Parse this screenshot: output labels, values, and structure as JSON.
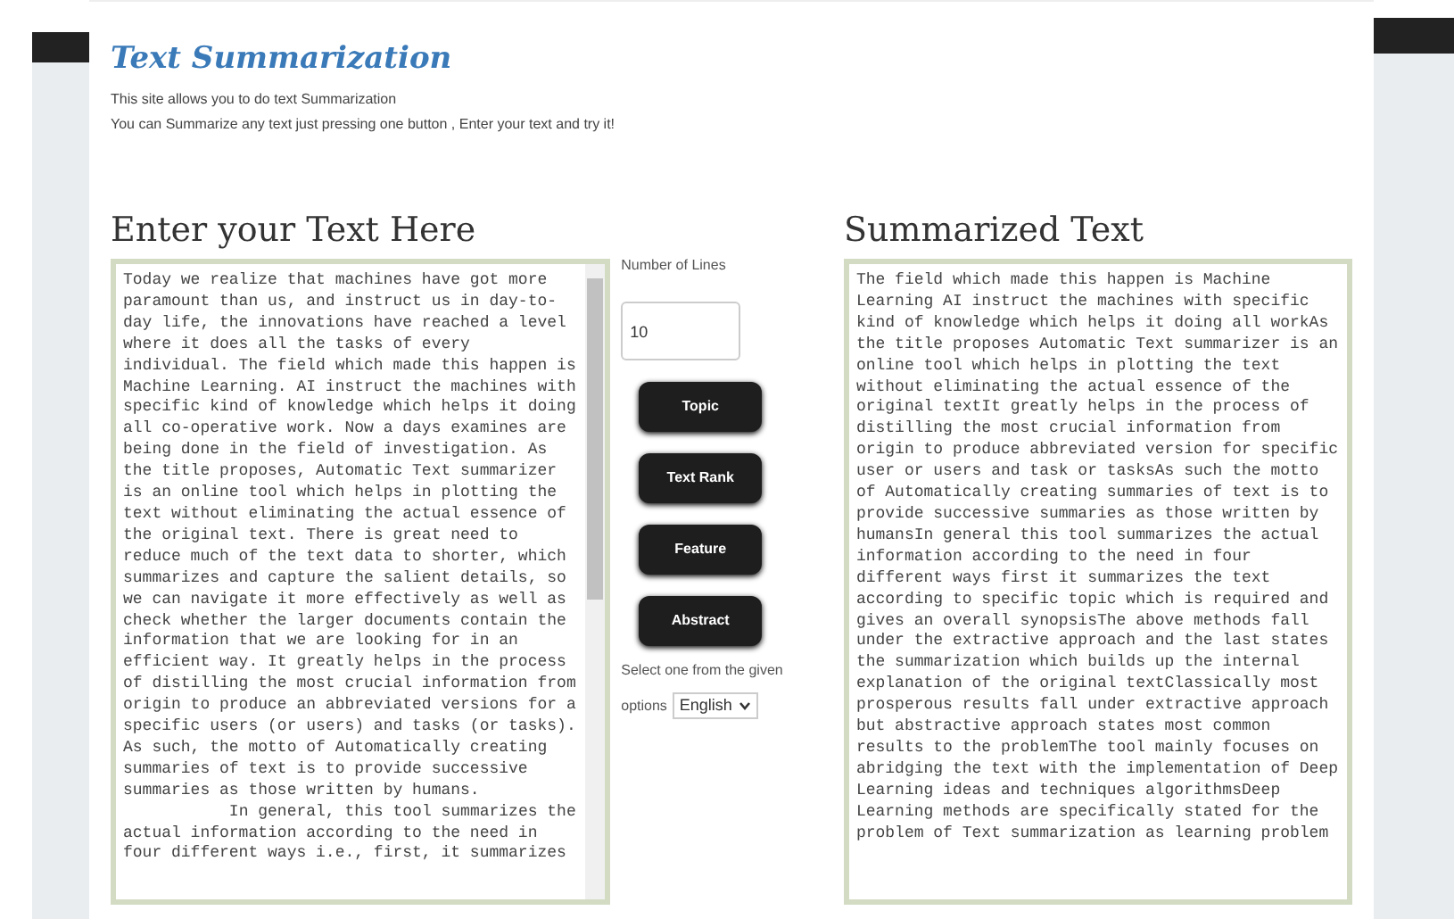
{
  "header": {
    "title": "Text Summarization",
    "lines": [
      "This site allows you to do text Summarization",
      "You can Summarize any text just pressing one button , Enter your text and try it!"
    ]
  },
  "input_panel": {
    "heading": "Enter your Text Here",
    "text": "Today we realize that machines have got more paramount than us, and instruct us in day-to-day life, the innovations have reached a level where it does all the tasks of every individual. The field which made this happen is Machine Learning. AI instruct the machines with specific kind of knowledge which helps it doing all co-operative work. Now a days examines are being done in the field of investigation. As the title proposes, Automatic Text summarizer is an online tool which helps in plotting the text without eliminating the actual essence of the original text. There is great need to reduce much of the text data to shorter, which summarizes and capture the salient details, so we can navigate it more effectively as well as check whether the larger documents contain the information that we are looking for in an efficient way. It greatly helps in the process of distilling the most crucial information from origin to produce an abbreviated versions for a specific users (or users) and tasks (or tasks). As such, the motto of Automatically creating summaries of text is to provide successive summaries as those written by humans.\n           In general, this tool summarizes the actual information according to the need in four different ways i.e., first, it summarizes"
  },
  "controls": {
    "lines_label": "Number of Lines",
    "lines_value": "10",
    "buttons": [
      "Topic",
      "Text Rank",
      "Feature",
      "Abstract"
    ],
    "select_label_1": "Select one from the given",
    "select_label_2": "options",
    "language": "English"
  },
  "output_panel": {
    "heading": "Summarized Text",
    "text": "The field which made this happen is Machine Learning AI instruct the machines with specific kind of knowledge which helps it doing all workAs the title proposes Automatic Text summarizer is an online tool which helps in plotting the text without eliminating the actual essence of the original textIt greatly helps in the process of distilling the most crucial information from origin to produce abbreviated version for specific user or users and task or tasksAs such the motto of Automatically creating summaries of text is to provide successive summaries as those written by humansIn general this tool summarizes the actual information according to the need in four different ways first it summarizes the text according to specific topic which is required and gives an overall synopsisThe above methods fall under the extractive approach and the last states the summarization which builds up the internal explanation of the original textClassically most prosperous results fall under extractive approach but abstractive approach states most common results to the problemThe tool mainly focuses on abridging the text with the implementation of Deep Learning ideas and techniques algorithmsDeep Learning methods are specifically stated for the problem of Text summarization as learning problem"
  }
}
